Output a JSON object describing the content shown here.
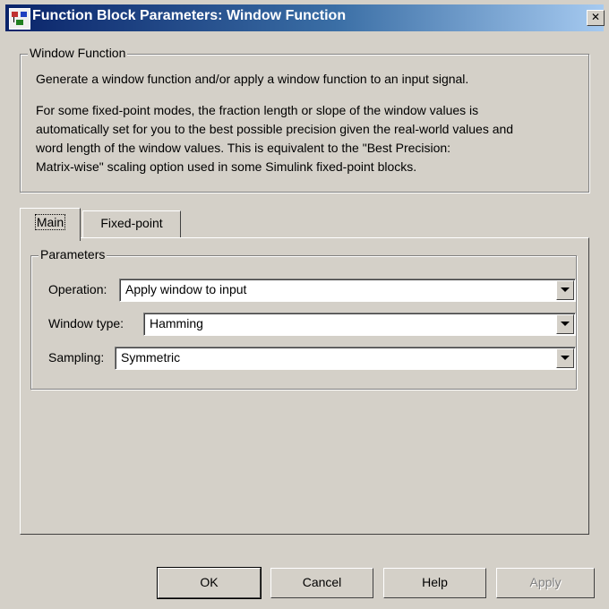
{
  "window": {
    "title": "Function Block Parameters: Window Function",
    "close_glyph": "✕"
  },
  "description": {
    "legend": "Window Function",
    "line1": "Generate a window function and/or apply a window function to an input signal.",
    "para2_lines": [
      "For some fixed-point modes, the fraction length or slope of the window values is",
      "automatically set for you to the best possible precision given the real-world values and",
      "word length of the window values. This is equivalent to the \"Best Precision:",
      "Matrix-wise\" scaling option used in some Simulink fixed-point blocks."
    ]
  },
  "tabs": [
    {
      "label": "Main",
      "active": true
    },
    {
      "label": "Fixed-point",
      "active": false
    }
  ],
  "parameters": {
    "legend": "Parameters",
    "operation": {
      "label": "Operation:",
      "value": "Apply window to input"
    },
    "window_type": {
      "label": "Window type:",
      "value": "Hamming"
    },
    "sampling": {
      "label": "Sampling:",
      "value": "Symmetric"
    }
  },
  "buttons": {
    "ok": "OK",
    "cancel": "Cancel",
    "help": "Help",
    "apply": "Apply"
  },
  "icons": {
    "app": "simulink-block-icon",
    "dropdown": "chevron-down-icon"
  }
}
